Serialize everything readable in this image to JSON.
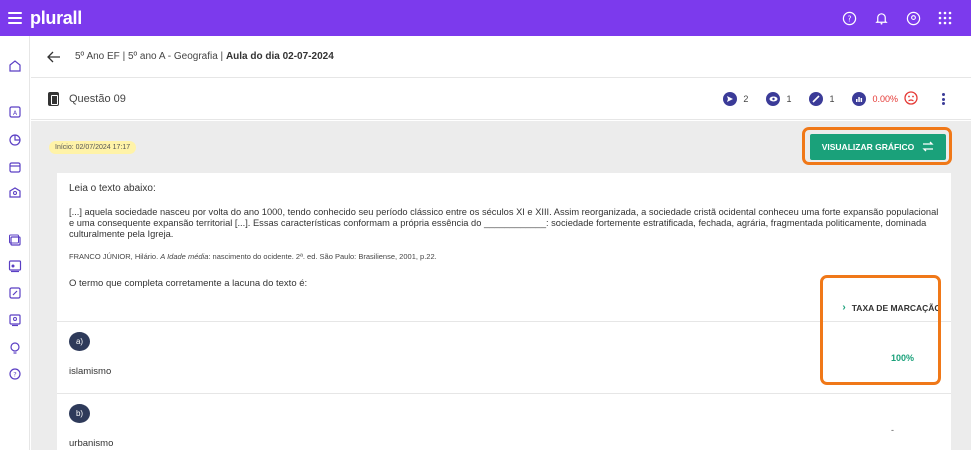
{
  "app": {
    "logo": "plurall"
  },
  "breadcrumb": {
    "prefix": "5º Ano EF | 5º ano A - Geografia |",
    "current": "Aula do dia 02-07-2024"
  },
  "question": {
    "title": "Questão 09",
    "stats": {
      "sent": "2",
      "viewed": "1",
      "answered": "1",
      "rate": "0.00%"
    }
  },
  "content": {
    "start_badge": "Início: 02/07/2024 17:17",
    "visualize_button": "VISUALIZAR GRÁFICO",
    "intro": "Leia o texto abaixo:",
    "passage": "[...] aquela sociedade nasceu por volta do ano 1000, tendo conhecido seu período clássico entre os séculos XI e XIII. Assim reorganizada, a sociedade cristã ocidental conheceu uma forte expansão populacional e uma consequente expansão territorial [...]. Essas características conformam a própria essência do ____________: sociedade fortemente estratificada, fechada, agrária, fragmentada politicamente, dominada culturalmente pela Igreja.",
    "source_a": "FRANCO JÚNIOR, Hilário.",
    "source_title": "A Idade média",
    "source_b": ": nascimento do ocidente. 2ª. ed. São Paulo: Brasiliense, 2001, p.22.",
    "prompt": "O termo que completa corretamente a lacuna do texto é:",
    "taxa_label": "TAXA DE MARCAÇÃO",
    "options": [
      {
        "letter": "a)",
        "text": "islamismo",
        "rate": "100%"
      },
      {
        "letter": "b)",
        "text": "urbanismo",
        "rate": "-"
      }
    ]
  },
  "colors": {
    "brand": "#7c3aed",
    "accent": "#1aa17a",
    "highlight": "#f07818",
    "danger": "#e53935"
  }
}
